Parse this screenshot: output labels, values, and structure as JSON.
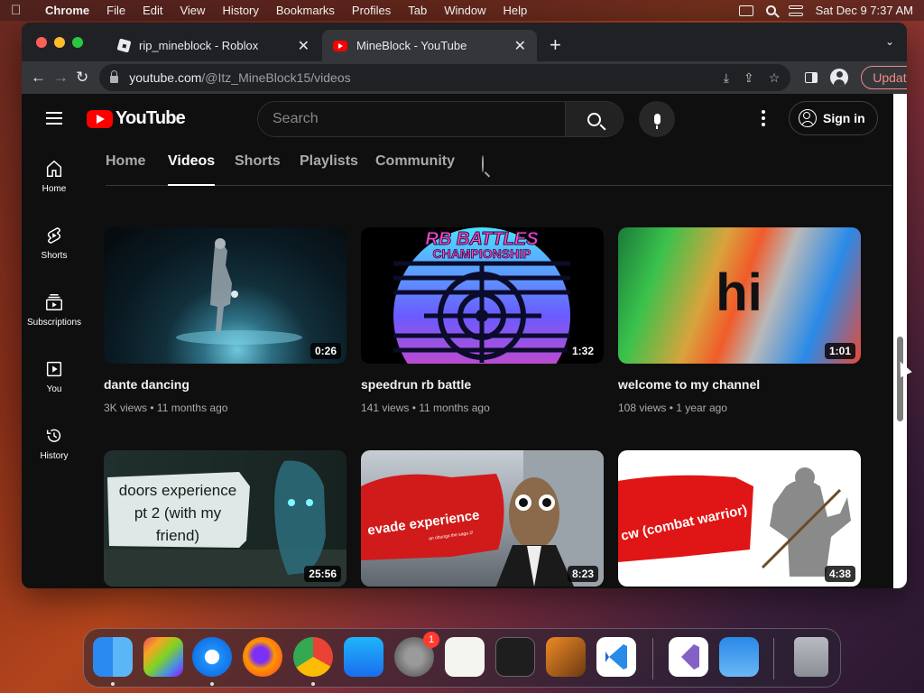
{
  "menubar": {
    "app_name": "Chrome",
    "menus": [
      "File",
      "Edit",
      "View",
      "History",
      "Bookmarks",
      "Profiles",
      "Tab",
      "Window",
      "Help"
    ],
    "clock": "Sat Dec 9  7:37 AM"
  },
  "browser": {
    "tabs": [
      {
        "title": "rip_mineblock - Roblox",
        "favicon": "roblox-icon"
      },
      {
        "title": "MineBlock - YouTube",
        "favicon": "youtube-icon"
      }
    ],
    "url_host": "youtube.com",
    "url_path": "/@Itz_MineBlock15/videos",
    "update_label": "Update"
  },
  "youtube": {
    "logo_text": "YouTube",
    "search_placeholder": "Search",
    "sign_in_label": "Sign in",
    "guide": [
      {
        "label": "Home",
        "icon": "home-icon"
      },
      {
        "label": "Shorts",
        "icon": "shorts-icon"
      },
      {
        "label": "Subscriptions",
        "icon": "subscriptions-icon"
      },
      {
        "label": "You",
        "icon": "you-icon"
      },
      {
        "label": "History",
        "icon": "history-icon"
      }
    ],
    "channel_tabs": [
      "Home",
      "Videos",
      "Shorts",
      "Playlists",
      "Community"
    ],
    "active_tab": "Videos",
    "videos": [
      {
        "title": "dante dancing",
        "views": "3K views",
        "age": "11 months ago",
        "duration": "0:26"
      },
      {
        "title": "speedrun rb battle",
        "views": "141 views",
        "age": "11 months ago",
        "duration": "1:32"
      },
      {
        "title": "welcome to my channel",
        "views": "108 views",
        "age": "1 year ago",
        "duration": "1:01"
      },
      {
        "title": "",
        "views": "",
        "age": "",
        "duration": "25:56"
      },
      {
        "title": "",
        "views": "",
        "age": "",
        "duration": "8:23"
      },
      {
        "title": "",
        "views": "",
        "age": "",
        "duration": "4:38"
      }
    ],
    "thumb_text": {
      "rb_battles": "RB BATTLES",
      "championship": "CHAMPIONSHIP",
      "hi": "hi",
      "doors": [
        "doors experience",
        "pt 2 (with my",
        "friend)"
      ],
      "evade": "evade experience",
      "evade_small": "an obunga the saga 2!",
      "cw": "cw (combat warrior)"
    },
    "meta_separator": "•"
  },
  "dock": {
    "apps": [
      "finder-icon",
      "launchpad-icon",
      "safari-icon",
      "firefox-icon",
      "chrome-icon",
      "app-store-icon",
      "system-settings-icon",
      "textedit-icon",
      "terminal-icon",
      "garageband-icon",
      "vscode-icon",
      "visual-studio-icon",
      "weather-icon",
      "trash-icon"
    ],
    "settings_badge": "1"
  }
}
